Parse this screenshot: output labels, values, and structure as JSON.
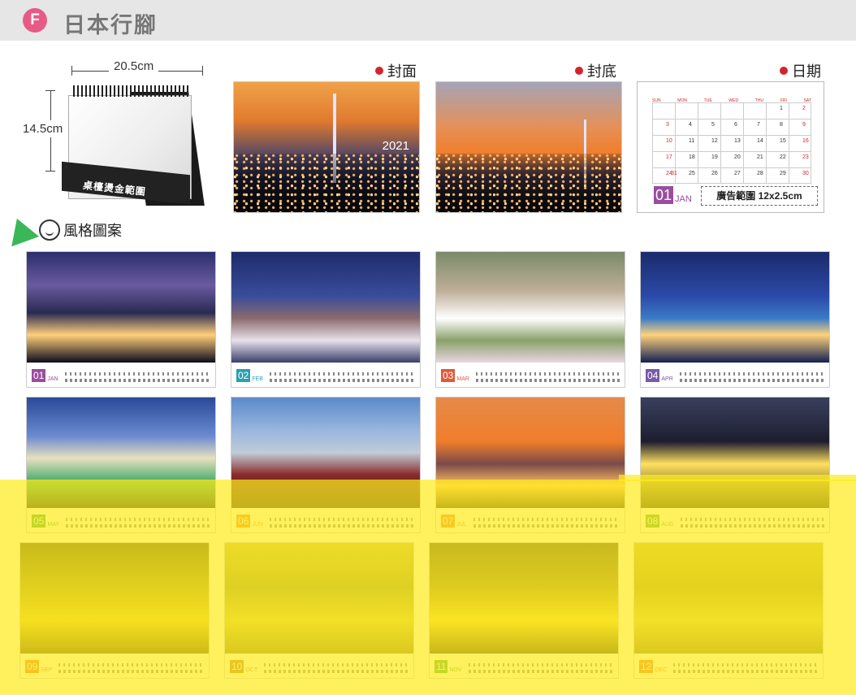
{
  "header": {
    "badge": "F",
    "title": "日本行腳"
  },
  "product": {
    "width_label": "20.5cm",
    "height_label": "14.5cm",
    "stand_label": "桌檯燙金範圍"
  },
  "sections": {
    "cover": "封面",
    "back_cover": "封底",
    "date": "日期",
    "style": "風格圖案"
  },
  "cover": {
    "year": "2021"
  },
  "date_page": {
    "weekdays": [
      "SUN",
      "MON",
      "TUE",
      "WED",
      "THU",
      "FRI",
      "SAT"
    ],
    "days": [
      "1",
      "2",
      "3",
      "4",
      "5",
      "6",
      "7",
      "8",
      "9",
      "10",
      "11",
      "12",
      "13",
      "14",
      "15",
      "16",
      "17",
      "18",
      "19",
      "20",
      "21",
      "22",
      "23",
      "24",
      "25",
      "26",
      "27",
      "28",
      "29",
      "30",
      "31"
    ],
    "month_num": "01",
    "month_name": "JAN",
    "ad_area": "廣告範圍 12x2.5cm"
  },
  "months": [
    {
      "num": "01",
      "name": "JAN",
      "color": "#9a4d9e",
      "bg": "bg-jan"
    },
    {
      "num": "02",
      "name": "FEB",
      "color": "#2aa0b0",
      "bg": "bg-feb"
    },
    {
      "num": "03",
      "name": "MAR",
      "color": "#e05a3a",
      "bg": "bg-mar"
    },
    {
      "num": "04",
      "name": "APR",
      "color": "#7a5aa8",
      "bg": "bg-apr"
    },
    {
      "num": "05",
      "name": "MAY",
      "color": "#2aa03a",
      "bg": "bg-may"
    },
    {
      "num": "06",
      "name": "JUN",
      "color": "#e07a2a",
      "bg": "bg-jun"
    },
    {
      "num": "07",
      "name": "JUL",
      "color": "#e0722a",
      "bg": "bg-jul"
    },
    {
      "num": "08",
      "name": "AUG",
      "color": "#4aa03a",
      "bg": "bg-aug"
    },
    {
      "num": "09",
      "name": "SEP",
      "color": "#e0602a",
      "bg": "bg-sep"
    },
    {
      "num": "10",
      "name": "OCT",
      "color": "#b06a2a",
      "bg": "bg-oct"
    },
    {
      "num": "11",
      "name": "NOV",
      "color": "#3aa03a",
      "bg": "bg-nov"
    },
    {
      "num": "12",
      "name": "DEC",
      "color": "#e06a2a",
      "bg": "bg-dec"
    }
  ]
}
